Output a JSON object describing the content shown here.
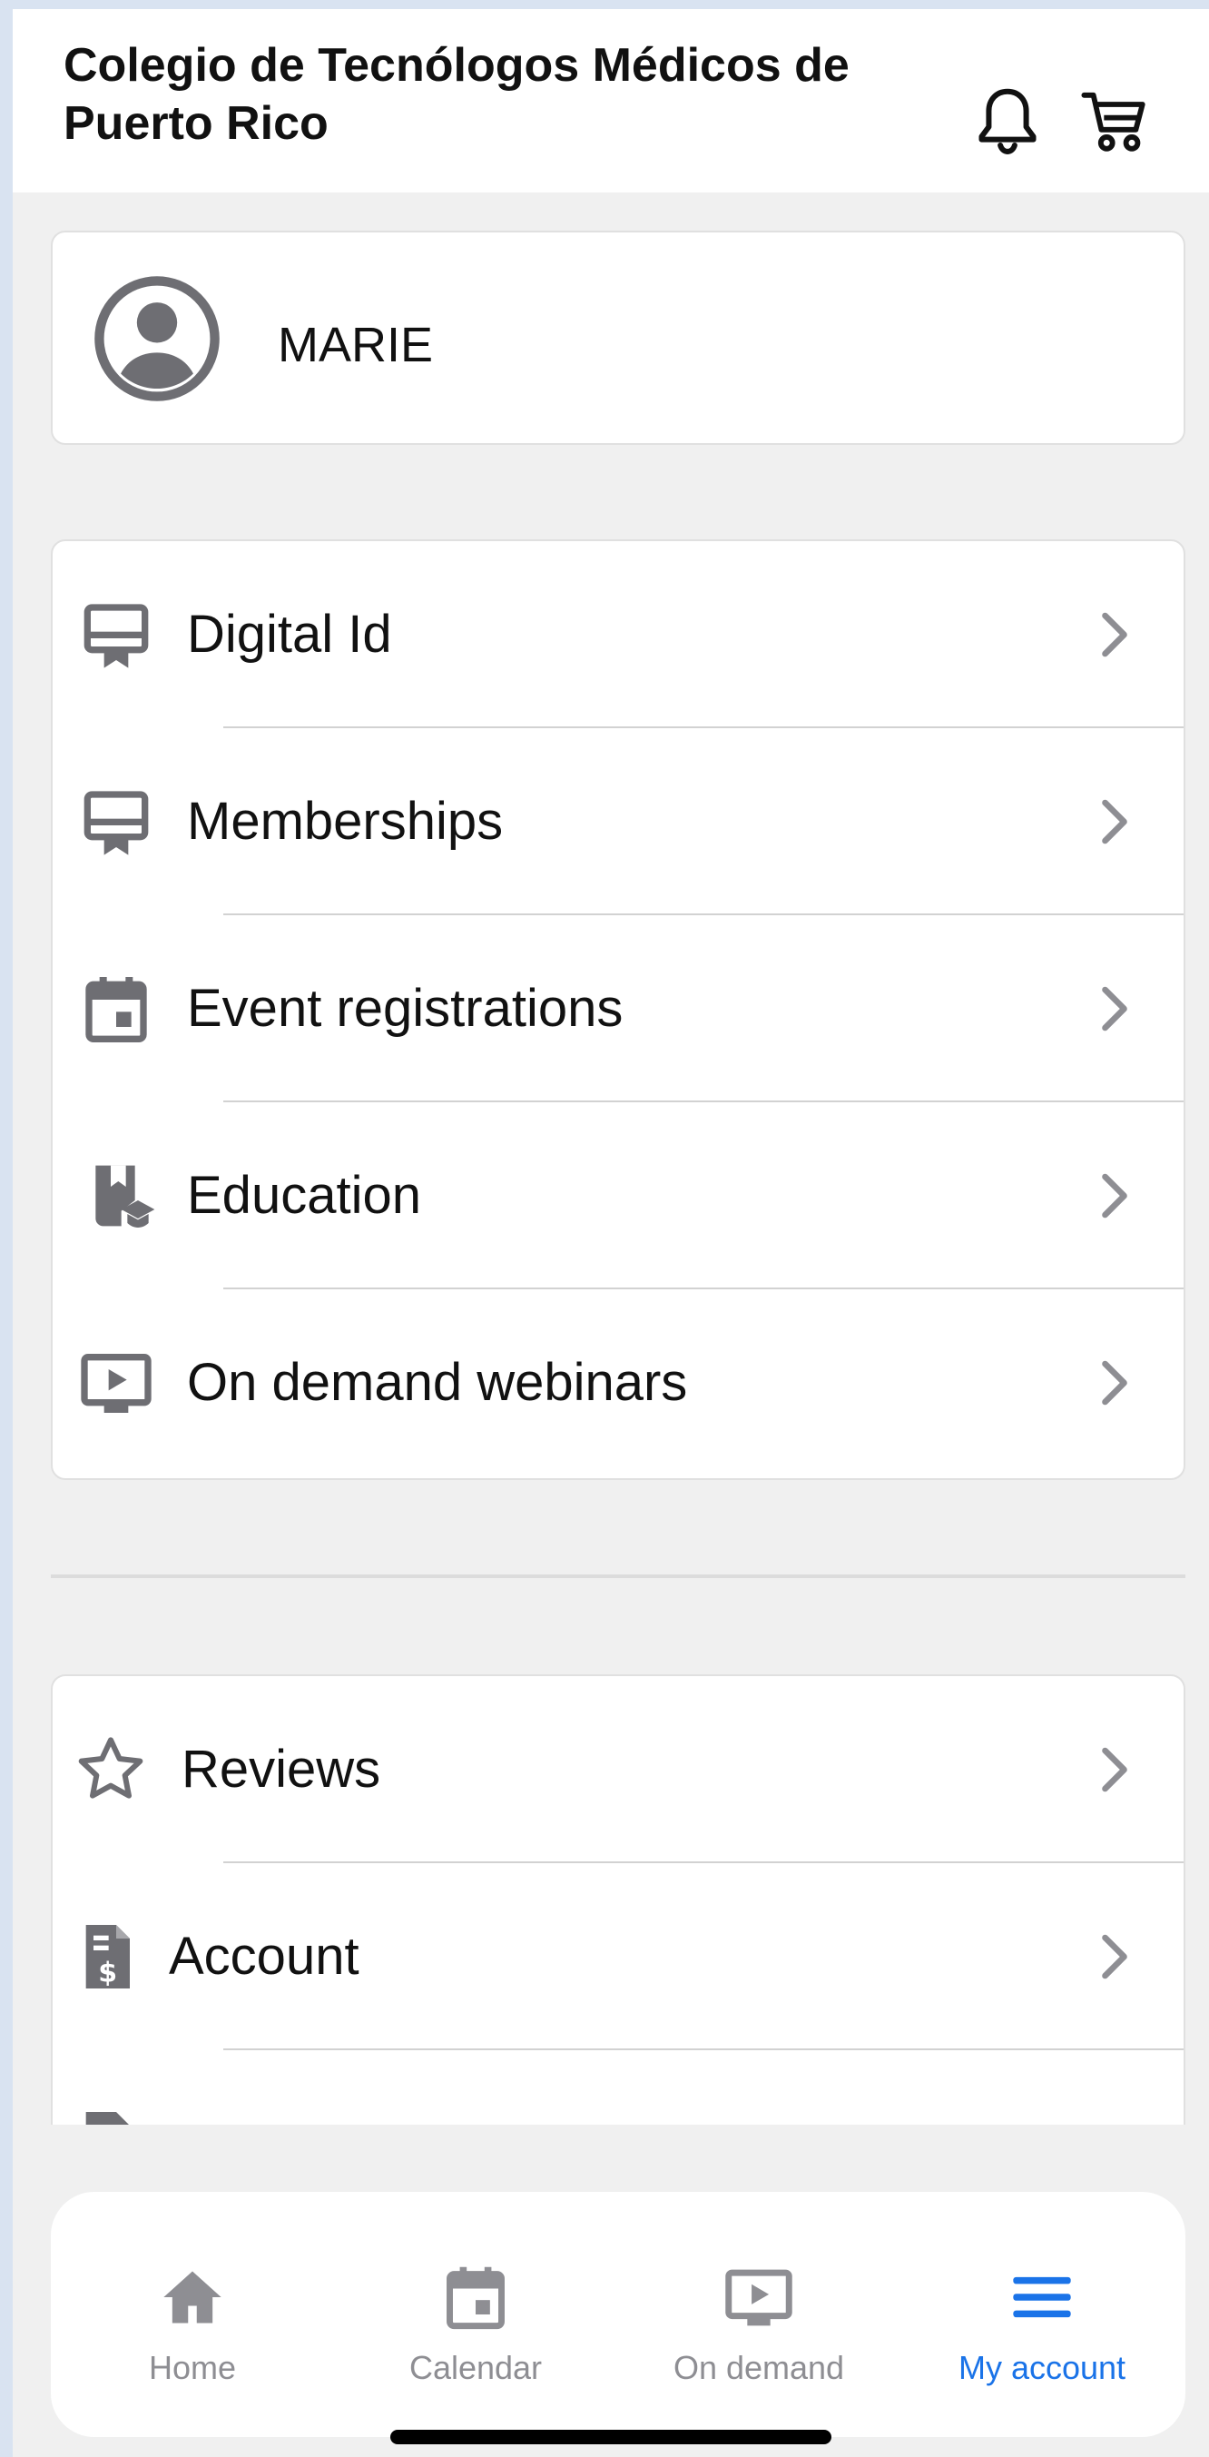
{
  "header": {
    "title": "Colegio de Tecnólogos Médicos de Puerto Rico",
    "notification_icon": "bell-icon",
    "cart_icon": "cart-icon"
  },
  "profile": {
    "avatar_icon": "user-circle-icon",
    "name": "MARIE"
  },
  "menu_primary": [
    {
      "label": "Digital Id",
      "icon": "badge-icon"
    },
    {
      "label": "Memberships",
      "icon": "badge-icon"
    },
    {
      "label": "Event registrations",
      "icon": "calendar-icon"
    },
    {
      "label": "Education",
      "icon": "book-graduation-icon"
    },
    {
      "label": "On demand webinars",
      "icon": "video-play-icon"
    }
  ],
  "menu_secondary": [
    {
      "label": "Reviews",
      "icon": "star-icon"
    },
    {
      "label": "Account",
      "icon": "invoice-dollar-icon"
    }
  ],
  "tabbar": {
    "active": "my_account",
    "tabs": [
      {
        "id": "home",
        "label": "Home",
        "icon": "home-icon"
      },
      {
        "id": "calendar",
        "label": "Calendar",
        "icon": "calendar-icon"
      },
      {
        "id": "on_demand",
        "label": "On demand",
        "icon": "video-play-icon"
      },
      {
        "id": "my_account",
        "label": "My account",
        "icon": "menu-icon"
      }
    ]
  },
  "colors": {
    "accent": "#1a73e8",
    "icon_gray": "#6e6e73",
    "background": "#f0f0f0",
    "frame": "#d9e3f1"
  }
}
